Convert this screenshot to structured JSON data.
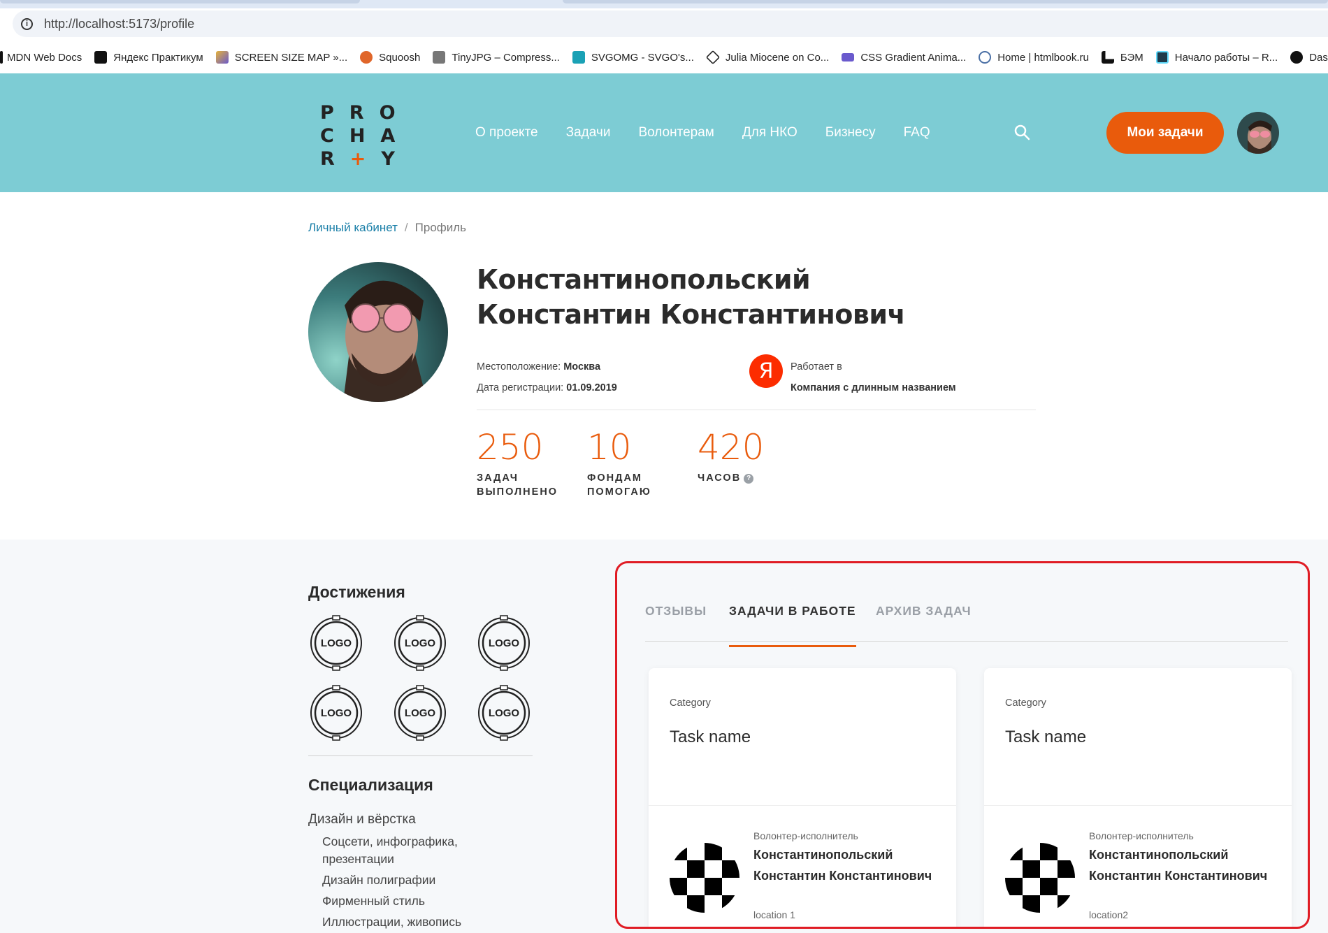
{
  "browser": {
    "url": "http://localhost:5173/profile",
    "bookmarks": [
      {
        "label": "MDN Web Docs",
        "color": "#ffffff"
      },
      {
        "label": "Яндекс Практикум",
        "color": "#111111"
      },
      {
        "label": "SCREEN SIZE MAP »...",
        "color": "#d9a32a"
      },
      {
        "label": "Squoosh",
        "color": "#e0662a"
      },
      {
        "label": "TinyJPG – Compress...",
        "color": "#555555"
      },
      {
        "label": "SVGOMG - SVGO's...",
        "color": "#1aa1b5"
      },
      {
        "label": "Julia Miocene on Co...",
        "color": "#222222"
      },
      {
        "label": "CSS Gradient Anima...",
        "color": "#6a5acd"
      },
      {
        "label": "Home | htmlbook.ru",
        "color": "#4a6fa5"
      },
      {
        "label": "БЭМ",
        "color": "#111111"
      },
      {
        "label": "Начало работы – R...",
        "color": "#1e3a4a"
      },
      {
        "label": "Dash fo",
        "color": "#111111"
      }
    ]
  },
  "header": {
    "logo": {
      "row1": "PRO",
      "row2": "CHA",
      "row3_a": "R",
      "row3_plus": "+",
      "row3_b": "Y"
    },
    "nav": [
      "О проекте",
      "Задачи",
      "Волонтерам",
      "Для НКО",
      "Бизнесу",
      "FAQ"
    ],
    "my_tasks_label": "Мои задачи",
    "accent": "#e95b0c",
    "bg": "#7dccd4"
  },
  "breadcrumb": {
    "link": "Личный кабинет",
    "separator": "/",
    "current": "Профиль"
  },
  "profile": {
    "name": "Константинопольский Константин Константинович",
    "location_label": "Местоположение:",
    "location": "Москва",
    "registered_label": "Дата регистрации:",
    "registered": "01.09.2019",
    "employer_logo_letter": "Я",
    "works_at_label": "Работает в",
    "company": "Компания с длинным названием",
    "stats": [
      {
        "value": "250",
        "label": "ЗАДАЧ ВЫПОЛНЕНО"
      },
      {
        "value": "10",
        "label": "ФОНДАМ ПОМОГАЮ"
      },
      {
        "value": "420",
        "label": "ЧАСОВ",
        "help": "?"
      }
    ]
  },
  "achievements": {
    "title": "Достижения",
    "badge_text": "LOGO",
    "badges": [
      "LOGO",
      "LOGO",
      "LOGO",
      "LOGO",
      "LOGO",
      "LOGO"
    ]
  },
  "specialization": {
    "title": "Специализация",
    "main": "Дизайн и вёрстка",
    "items": [
      "Соцсети, инфографика, презентации",
      "Дизайн полиграфии",
      "Фирменный стиль",
      "Иллюстрации, живопись"
    ]
  },
  "tasks": {
    "tabs": [
      {
        "label": "ОТЗЫВЫ",
        "active": false
      },
      {
        "label": "ЗАДАЧИ В РАБОТЕ",
        "active": true
      },
      {
        "label": "АРХИВ ЗАДАЧ",
        "active": false
      }
    ],
    "cards": [
      {
        "category": "Category",
        "title": "Task name",
        "role": "Волонтер-исполнитель",
        "name": "Константинопольский Константин Константинович",
        "location": "location 1"
      },
      {
        "category": "Category",
        "title": "Task name",
        "role": "Волонтер-исполнитель",
        "name": "Константинопольский Константин Константинович",
        "location": "location2"
      }
    ]
  }
}
